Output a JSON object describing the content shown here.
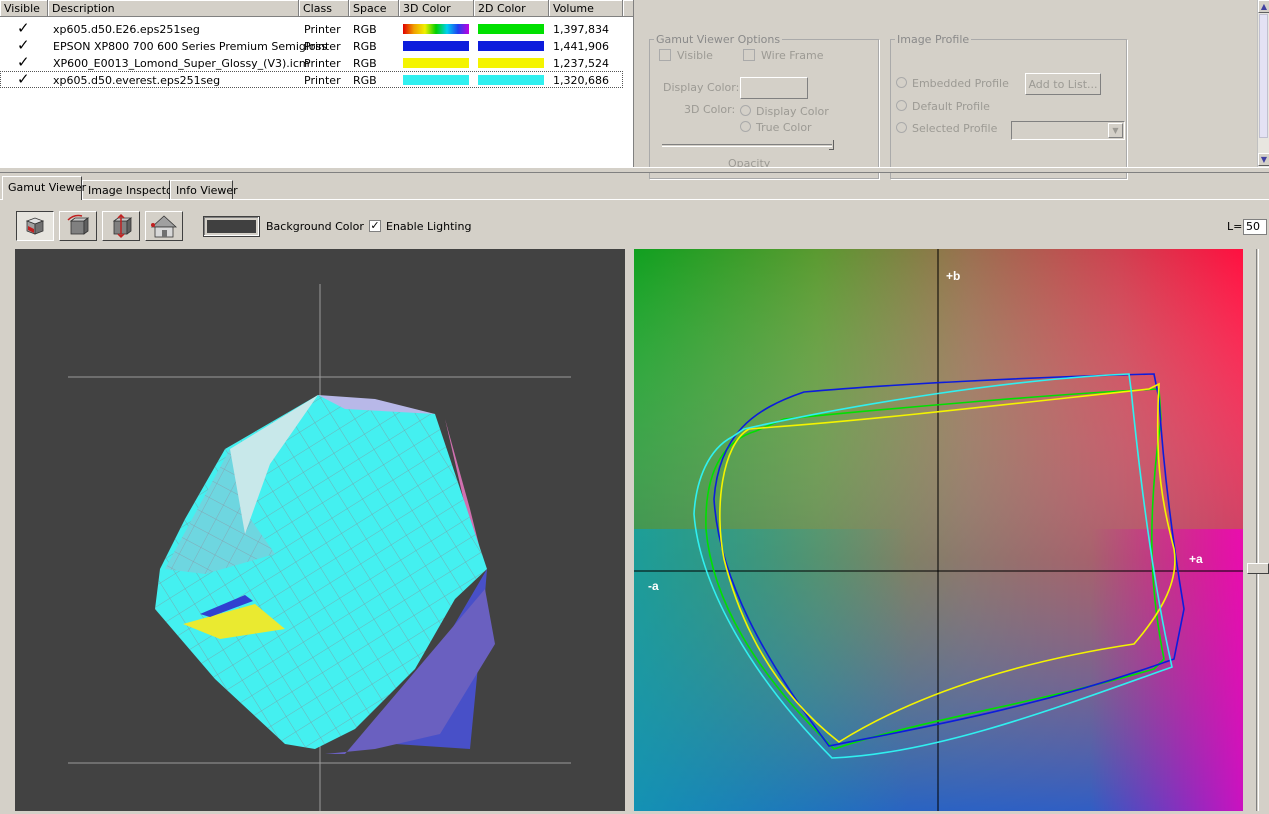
{
  "list": {
    "headers": [
      "Visible",
      "Description",
      "Class",
      "Space",
      "3D Color",
      "2D Color",
      "Volume"
    ],
    "rows": [
      {
        "description": "xp605.d50.E26.eps251seg",
        "class": "Printer",
        "space": "RGB",
        "color3d": "rainbow",
        "color2d": "#00e000",
        "volume": "1,397,834"
      },
      {
        "description": "EPSON XP800 700 600 Series Premium Semigloss",
        "class": "Printer",
        "space": "RGB",
        "color3d": "#0c1cdc",
        "color2d": "#0c1cdc",
        "volume": "1,441,906"
      },
      {
        "description": "XP600_E0013_Lomond_Super_Glossy_(V3).icm",
        "class": "Printer",
        "space": "RGB",
        "color3d": "#f4f400",
        "color2d": "#f4f400",
        "volume": "1,237,524"
      },
      {
        "description": "xp605.d50.everest.eps251seg",
        "class": "Printer",
        "space": "RGB",
        "color3d": "#30f0f0",
        "color2d": "#30f0f0",
        "volume": "1,320,686"
      }
    ]
  },
  "options": {
    "title": "Gamut Viewer Options",
    "visible": "Visible",
    "wireframe": "Wire Frame",
    "display_color": "Display Color:",
    "color3d": "3D Color:",
    "radio_display": "Display Color",
    "radio_true": "True Color",
    "opacity": "Opacity"
  },
  "image_profile": {
    "title": "Image Profile",
    "embedded": "Embedded Profile",
    "default": "Default Profile",
    "selected": "Selected Profile",
    "add_button": "Add to List..."
  },
  "tabs": [
    "Gamut Viewer",
    "Image Inspector",
    "Info Viewer"
  ],
  "toolbar": {
    "tools": [
      "cube-view-icon",
      "rotate-icon",
      "move-icon",
      "home-icon"
    ],
    "background_label": "Background Color",
    "lighting_label": "Enable Lighting",
    "lighting_checked": true,
    "l_label": "L=",
    "l_value": "50"
  },
  "plot2d": {
    "plus_b": "+b",
    "plus_a": "+a",
    "minus_a": "-a"
  },
  "colors": {
    "chrome": "#d4d0c8",
    "view3d_bg": "#424242",
    "gamut_green": "#00e000",
    "gamut_blue": "#0c1cdc",
    "gamut_yellow": "#f4f400",
    "gamut_cyan": "#30f0f0"
  }
}
